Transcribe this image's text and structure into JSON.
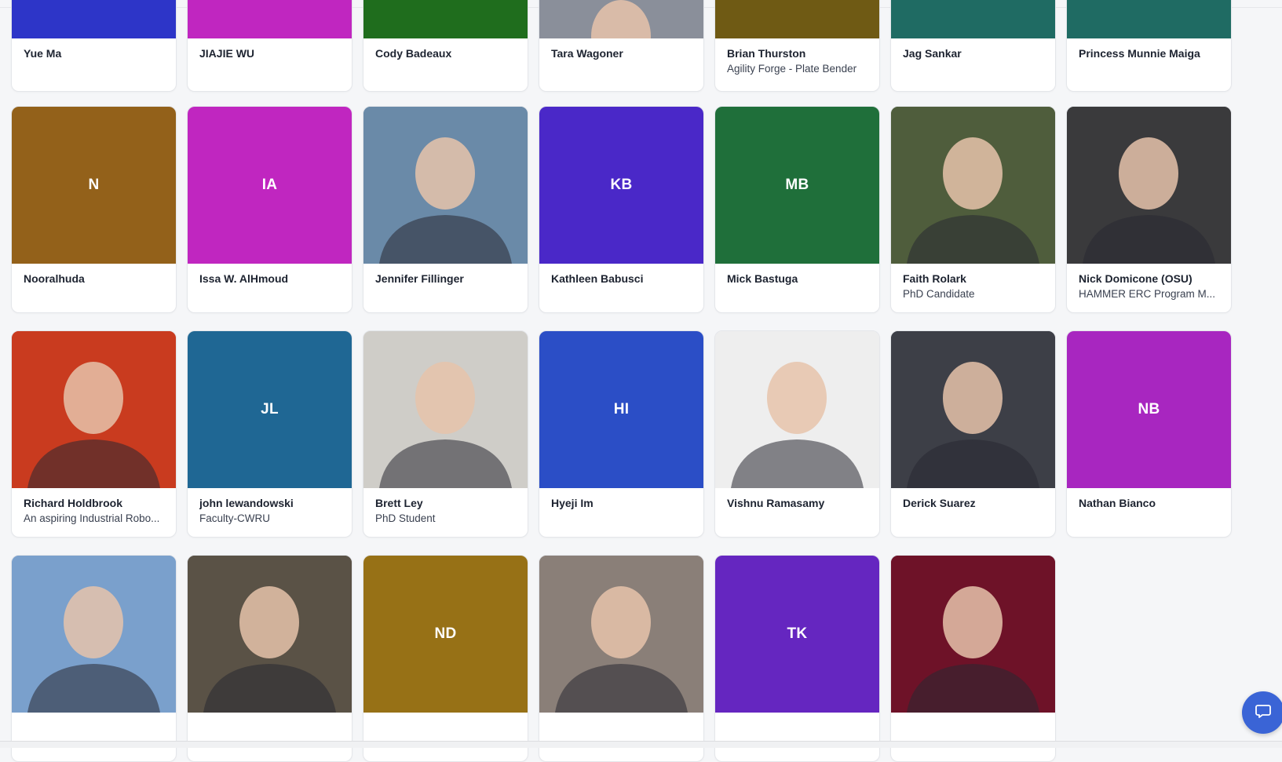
{
  "rows": [
    {
      "cards": [
        {
          "name": "Yue Ma",
          "subtitle": "",
          "initials": "",
          "color": "#2d35c8",
          "photo": ""
        },
        {
          "name": "JIAJIE WU",
          "subtitle": "",
          "initials": "",
          "color": "#c026c0",
          "photo": ""
        },
        {
          "name": "Cody Badeaux",
          "subtitle": "",
          "initials": "",
          "color": "#1f6d1d",
          "photo": ""
        },
        {
          "name": "Tara Wagoner",
          "subtitle": "",
          "initials": "",
          "color": "#8a8f9a",
          "photo": "person"
        },
        {
          "name": "Brian Thurston",
          "subtitle": "Agility Forge - Plate Bender",
          "initials": "",
          "color": "#6f5a14",
          "photo": ""
        },
        {
          "name": "Jag Sankar",
          "subtitle": "",
          "initials": "",
          "color": "#1f6b63",
          "photo": ""
        },
        {
          "name": "Princess Munnie Maiga",
          "subtitle": "",
          "initials": "",
          "color": "#1f6b63",
          "photo": ""
        }
      ]
    },
    {
      "cards": [
        {
          "name": "Nooralhuda",
          "subtitle": "",
          "initials": "N",
          "color": "#93611a",
          "photo": ""
        },
        {
          "name": "Issa W. AlHmoud",
          "subtitle": "",
          "initials": "IA",
          "color": "#c026c0",
          "photo": ""
        },
        {
          "name": "Jennifer Fillinger",
          "subtitle": "",
          "initials": "",
          "color": "#6a8aa8",
          "photo": "person"
        },
        {
          "name": "Kathleen Babusci",
          "subtitle": "",
          "initials": "KB",
          "color": "#4a28c8",
          "photo": ""
        },
        {
          "name": "Mick Bastuga",
          "subtitle": "",
          "initials": "MB",
          "color": "#1f6f3a",
          "photo": ""
        },
        {
          "name": "Faith Rolark",
          "subtitle": "PhD Candidate",
          "initials": "",
          "color": "#4f5d3c",
          "photo": "person"
        },
        {
          "name": "Nick Domicone (OSU)",
          "subtitle": "HAMMER ERC Program M...",
          "initials": "",
          "color": "#3a3a3c",
          "photo": "person"
        }
      ]
    },
    {
      "cards": [
        {
          "name": "Richard Holdbrook",
          "subtitle": "An aspiring Industrial Robo...",
          "initials": "",
          "color": "#c93b1f",
          "photo": "person"
        },
        {
          "name": "john lewandowski",
          "subtitle": "Faculty-CWRU",
          "initials": "JL",
          "color": "#1f6794",
          "photo": ""
        },
        {
          "name": "Brett Ley",
          "subtitle": "PhD Student",
          "initials": "",
          "color": "#cfcdc8",
          "photo": "person"
        },
        {
          "name": "Hyeji Im",
          "subtitle": "",
          "initials": "HI",
          "color": "#2b4ec6",
          "photo": ""
        },
        {
          "name": "Vishnu Ramasamy",
          "subtitle": "",
          "initials": "",
          "color": "#eeeeee",
          "photo": "person"
        },
        {
          "name": "Derick Suarez",
          "subtitle": "",
          "initials": "",
          "color": "#3d3f47",
          "photo": "person"
        },
        {
          "name": "Nathan Bianco",
          "subtitle": "",
          "initials": "NB",
          "color": "#a826c0",
          "photo": ""
        }
      ]
    },
    {
      "cards": [
        {
          "name": "",
          "subtitle": "",
          "initials": "",
          "color": "#7aa0cc",
          "photo": "person"
        },
        {
          "name": "",
          "subtitle": "",
          "initials": "",
          "color": "#5a5246",
          "photo": "person"
        },
        {
          "name": "",
          "subtitle": "",
          "initials": "ND",
          "color": "#977116",
          "photo": ""
        },
        {
          "name": "",
          "subtitle": "",
          "initials": "",
          "color": "#8a7f78",
          "photo": "person"
        },
        {
          "name": "",
          "subtitle": "",
          "initials": "TK",
          "color": "#6526c0",
          "photo": ""
        },
        {
          "name": "",
          "subtitle": "",
          "initials": "",
          "color": "#6e1228",
          "photo": "person"
        }
      ]
    }
  ],
  "chat": {
    "icon": "chat-bubble-icon"
  }
}
